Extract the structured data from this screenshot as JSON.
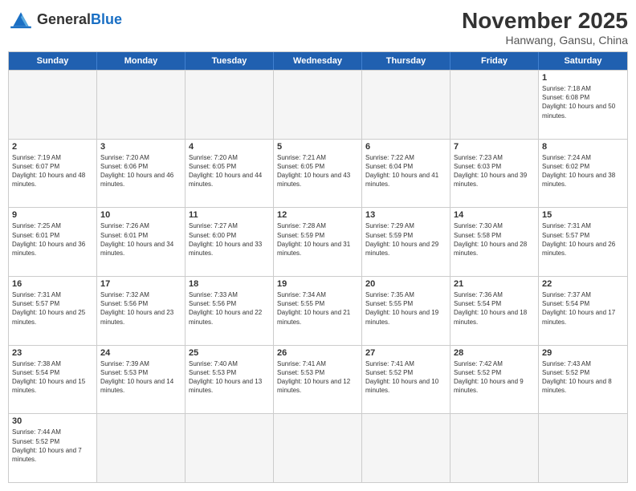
{
  "header": {
    "logo_general": "General",
    "logo_blue": "Blue",
    "month_title": "November 2025",
    "subtitle": "Hanwang, Gansu, China"
  },
  "days_of_week": [
    "Sunday",
    "Monday",
    "Tuesday",
    "Wednesday",
    "Thursday",
    "Friday",
    "Saturday"
  ],
  "weeks": [
    [
      {
        "day": "",
        "info": "",
        "empty": true
      },
      {
        "day": "",
        "info": "",
        "empty": true
      },
      {
        "day": "",
        "info": "",
        "empty": true
      },
      {
        "day": "",
        "info": "",
        "empty": true
      },
      {
        "day": "",
        "info": "",
        "empty": true
      },
      {
        "day": "",
        "info": "",
        "empty": true
      },
      {
        "day": "1",
        "info": "Sunrise: 7:18 AM\nSunset: 6:08 PM\nDaylight: 10 hours and 50 minutes.",
        "empty": false
      }
    ],
    [
      {
        "day": "2",
        "info": "Sunrise: 7:19 AM\nSunset: 6:07 PM\nDaylight: 10 hours and 48 minutes.",
        "empty": false
      },
      {
        "day": "3",
        "info": "Sunrise: 7:20 AM\nSunset: 6:06 PM\nDaylight: 10 hours and 46 minutes.",
        "empty": false
      },
      {
        "day": "4",
        "info": "Sunrise: 7:20 AM\nSunset: 6:05 PM\nDaylight: 10 hours and 44 minutes.",
        "empty": false
      },
      {
        "day": "5",
        "info": "Sunrise: 7:21 AM\nSunset: 6:05 PM\nDaylight: 10 hours and 43 minutes.",
        "empty": false
      },
      {
        "day": "6",
        "info": "Sunrise: 7:22 AM\nSunset: 6:04 PM\nDaylight: 10 hours and 41 minutes.",
        "empty": false
      },
      {
        "day": "7",
        "info": "Sunrise: 7:23 AM\nSunset: 6:03 PM\nDaylight: 10 hours and 39 minutes.",
        "empty": false
      },
      {
        "day": "8",
        "info": "Sunrise: 7:24 AM\nSunset: 6:02 PM\nDaylight: 10 hours and 38 minutes.",
        "empty": false
      }
    ],
    [
      {
        "day": "9",
        "info": "Sunrise: 7:25 AM\nSunset: 6:01 PM\nDaylight: 10 hours and 36 minutes.",
        "empty": false
      },
      {
        "day": "10",
        "info": "Sunrise: 7:26 AM\nSunset: 6:01 PM\nDaylight: 10 hours and 34 minutes.",
        "empty": false
      },
      {
        "day": "11",
        "info": "Sunrise: 7:27 AM\nSunset: 6:00 PM\nDaylight: 10 hours and 33 minutes.",
        "empty": false
      },
      {
        "day": "12",
        "info": "Sunrise: 7:28 AM\nSunset: 5:59 PM\nDaylight: 10 hours and 31 minutes.",
        "empty": false
      },
      {
        "day": "13",
        "info": "Sunrise: 7:29 AM\nSunset: 5:59 PM\nDaylight: 10 hours and 29 minutes.",
        "empty": false
      },
      {
        "day": "14",
        "info": "Sunrise: 7:30 AM\nSunset: 5:58 PM\nDaylight: 10 hours and 28 minutes.",
        "empty": false
      },
      {
        "day": "15",
        "info": "Sunrise: 7:31 AM\nSunset: 5:57 PM\nDaylight: 10 hours and 26 minutes.",
        "empty": false
      }
    ],
    [
      {
        "day": "16",
        "info": "Sunrise: 7:31 AM\nSunset: 5:57 PM\nDaylight: 10 hours and 25 minutes.",
        "empty": false
      },
      {
        "day": "17",
        "info": "Sunrise: 7:32 AM\nSunset: 5:56 PM\nDaylight: 10 hours and 23 minutes.",
        "empty": false
      },
      {
        "day": "18",
        "info": "Sunrise: 7:33 AM\nSunset: 5:56 PM\nDaylight: 10 hours and 22 minutes.",
        "empty": false
      },
      {
        "day": "19",
        "info": "Sunrise: 7:34 AM\nSunset: 5:55 PM\nDaylight: 10 hours and 21 minutes.",
        "empty": false
      },
      {
        "day": "20",
        "info": "Sunrise: 7:35 AM\nSunset: 5:55 PM\nDaylight: 10 hours and 19 minutes.",
        "empty": false
      },
      {
        "day": "21",
        "info": "Sunrise: 7:36 AM\nSunset: 5:54 PM\nDaylight: 10 hours and 18 minutes.",
        "empty": false
      },
      {
        "day": "22",
        "info": "Sunrise: 7:37 AM\nSunset: 5:54 PM\nDaylight: 10 hours and 17 minutes.",
        "empty": false
      }
    ],
    [
      {
        "day": "23",
        "info": "Sunrise: 7:38 AM\nSunset: 5:54 PM\nDaylight: 10 hours and 15 minutes.",
        "empty": false
      },
      {
        "day": "24",
        "info": "Sunrise: 7:39 AM\nSunset: 5:53 PM\nDaylight: 10 hours and 14 minutes.",
        "empty": false
      },
      {
        "day": "25",
        "info": "Sunrise: 7:40 AM\nSunset: 5:53 PM\nDaylight: 10 hours and 13 minutes.",
        "empty": false
      },
      {
        "day": "26",
        "info": "Sunrise: 7:41 AM\nSunset: 5:53 PM\nDaylight: 10 hours and 12 minutes.",
        "empty": false
      },
      {
        "day": "27",
        "info": "Sunrise: 7:41 AM\nSunset: 5:52 PM\nDaylight: 10 hours and 10 minutes.",
        "empty": false
      },
      {
        "day": "28",
        "info": "Sunrise: 7:42 AM\nSunset: 5:52 PM\nDaylight: 10 hours and 9 minutes.",
        "empty": false
      },
      {
        "day": "29",
        "info": "Sunrise: 7:43 AM\nSunset: 5:52 PM\nDaylight: 10 hours and 8 minutes.",
        "empty": false
      }
    ],
    [
      {
        "day": "30",
        "info": "Sunrise: 7:44 AM\nSunset: 5:52 PM\nDaylight: 10 hours and 7 minutes.",
        "empty": false
      },
      {
        "day": "",
        "info": "",
        "empty": true
      },
      {
        "day": "",
        "info": "",
        "empty": true
      },
      {
        "day": "",
        "info": "",
        "empty": true
      },
      {
        "day": "",
        "info": "",
        "empty": true
      },
      {
        "day": "",
        "info": "",
        "empty": true
      },
      {
        "day": "",
        "info": "",
        "empty": true
      }
    ]
  ]
}
